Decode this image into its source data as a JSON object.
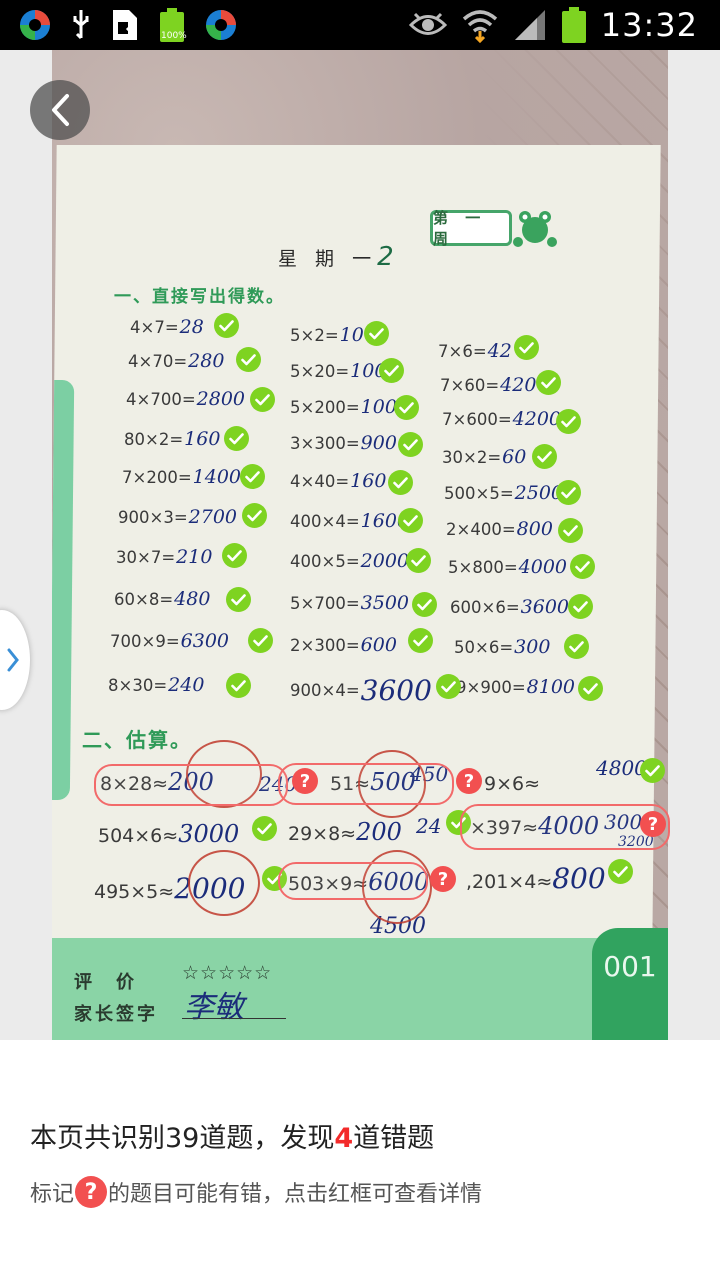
{
  "status_bar": {
    "time": "13:32",
    "battery_text": "100%",
    "left_icons": [
      "app-icon",
      "usb-icon",
      "sim-card-icon",
      "battery-full-icon",
      "app-icon"
    ],
    "right_icons": [
      "eye-icon",
      "wifi-icon",
      "signal-icon",
      "battery-icon"
    ]
  },
  "worksheet": {
    "week_badge": "第 一 周",
    "day_heading": "星 期 一",
    "day_number": "2",
    "section1_title": "一、直接写出得数。",
    "section2_title": "二、估算。",
    "rating_label": "评　价",
    "rating_stars": "☆☆☆☆☆",
    "parent_sign_label": "家长签字",
    "signature": "李敏",
    "page_number": "001",
    "col1": [
      {
        "q": "4×7=",
        "a": "28"
      },
      {
        "q": "4×70=",
        "a": "280"
      },
      {
        "q": "4×700=",
        "a": "2800"
      },
      {
        "q": "80×2=",
        "a": "160"
      },
      {
        "q": "7×200=",
        "a": "1400"
      },
      {
        "q": "900×3=",
        "a": "2700"
      },
      {
        "q": "30×7=",
        "a": "210"
      },
      {
        "q": "60×8=",
        "a": "480"
      },
      {
        "q": "700×9=",
        "a": "6300"
      },
      {
        "q": "8×30=",
        "a": "240"
      }
    ],
    "col2": [
      {
        "q": "5×2=",
        "a": "10"
      },
      {
        "q": "5×20=",
        "a": "100"
      },
      {
        "q": "5×200=",
        "a": "1000"
      },
      {
        "q": "3×300=",
        "a": "900"
      },
      {
        "q": "4×40=",
        "a": "160"
      },
      {
        "q": "400×4=",
        "a": "1600"
      },
      {
        "q": "400×5=",
        "a": "2000"
      },
      {
        "q": "5×700=",
        "a": "3500"
      },
      {
        "q": "2×300=",
        "a": "600"
      },
      {
        "q": "900×4=",
        "a": "3600"
      }
    ],
    "col3": [
      {
        "q": "7×6=",
        "a": "42"
      },
      {
        "q": "7×60=",
        "a": "420"
      },
      {
        "q": "7×600=",
        "a": "4200"
      },
      {
        "q": "30×2=",
        "a": "60"
      },
      {
        "q": "500×5=",
        "a": "2500"
      },
      {
        "q": "2×400=",
        "a": "800"
      },
      {
        "q": "5×800=",
        "a": "4000"
      },
      {
        "q": "600×6=",
        "a": "3600"
      },
      {
        "q": "50×6=",
        "a": "300"
      },
      {
        "q": "9×900=",
        "a": "8100"
      }
    ],
    "estimation": {
      "r1": [
        {
          "q": "8×28≈",
          "a": "200",
          "scrawl": "240"
        },
        {
          "q": "51≈",
          "a": "500",
          "scrawl": "450"
        },
        {
          "q": "9×6≈",
          "a": "",
          "scrawl": "4800"
        }
      ],
      "r2": [
        {
          "q": "504×6≈",
          "a": "3000"
        },
        {
          "q": "29×8≈",
          "a": "200",
          "scrawl": "24"
        },
        {
          "q": "×397≈",
          "a": "4000",
          "scrawl": "300"
        }
      ],
      "r3": [
        {
          "q": "495×5≈",
          "a": "2000"
        },
        {
          "q": "503×9≈",
          "a": "6000"
        },
        {
          "q": ",201×4≈",
          "a": "800"
        }
      ],
      "extra_scrawl": "4500",
      "extra_scrawl_2": "3200"
    }
  },
  "result": {
    "summary_prefix": "本页共识别39道题，发现",
    "error_count": "4",
    "summary_suffix": "道错题",
    "hint_prefix": "标记",
    "hint_mark": "?",
    "hint_suffix": "的题目可能有错，点击红框可查看详情"
  },
  "colors": {
    "check_green": "#7ed321",
    "error_red": "#f25050",
    "highlight_red": "#f32a2a",
    "worksheet_green": "#31a35f"
  }
}
